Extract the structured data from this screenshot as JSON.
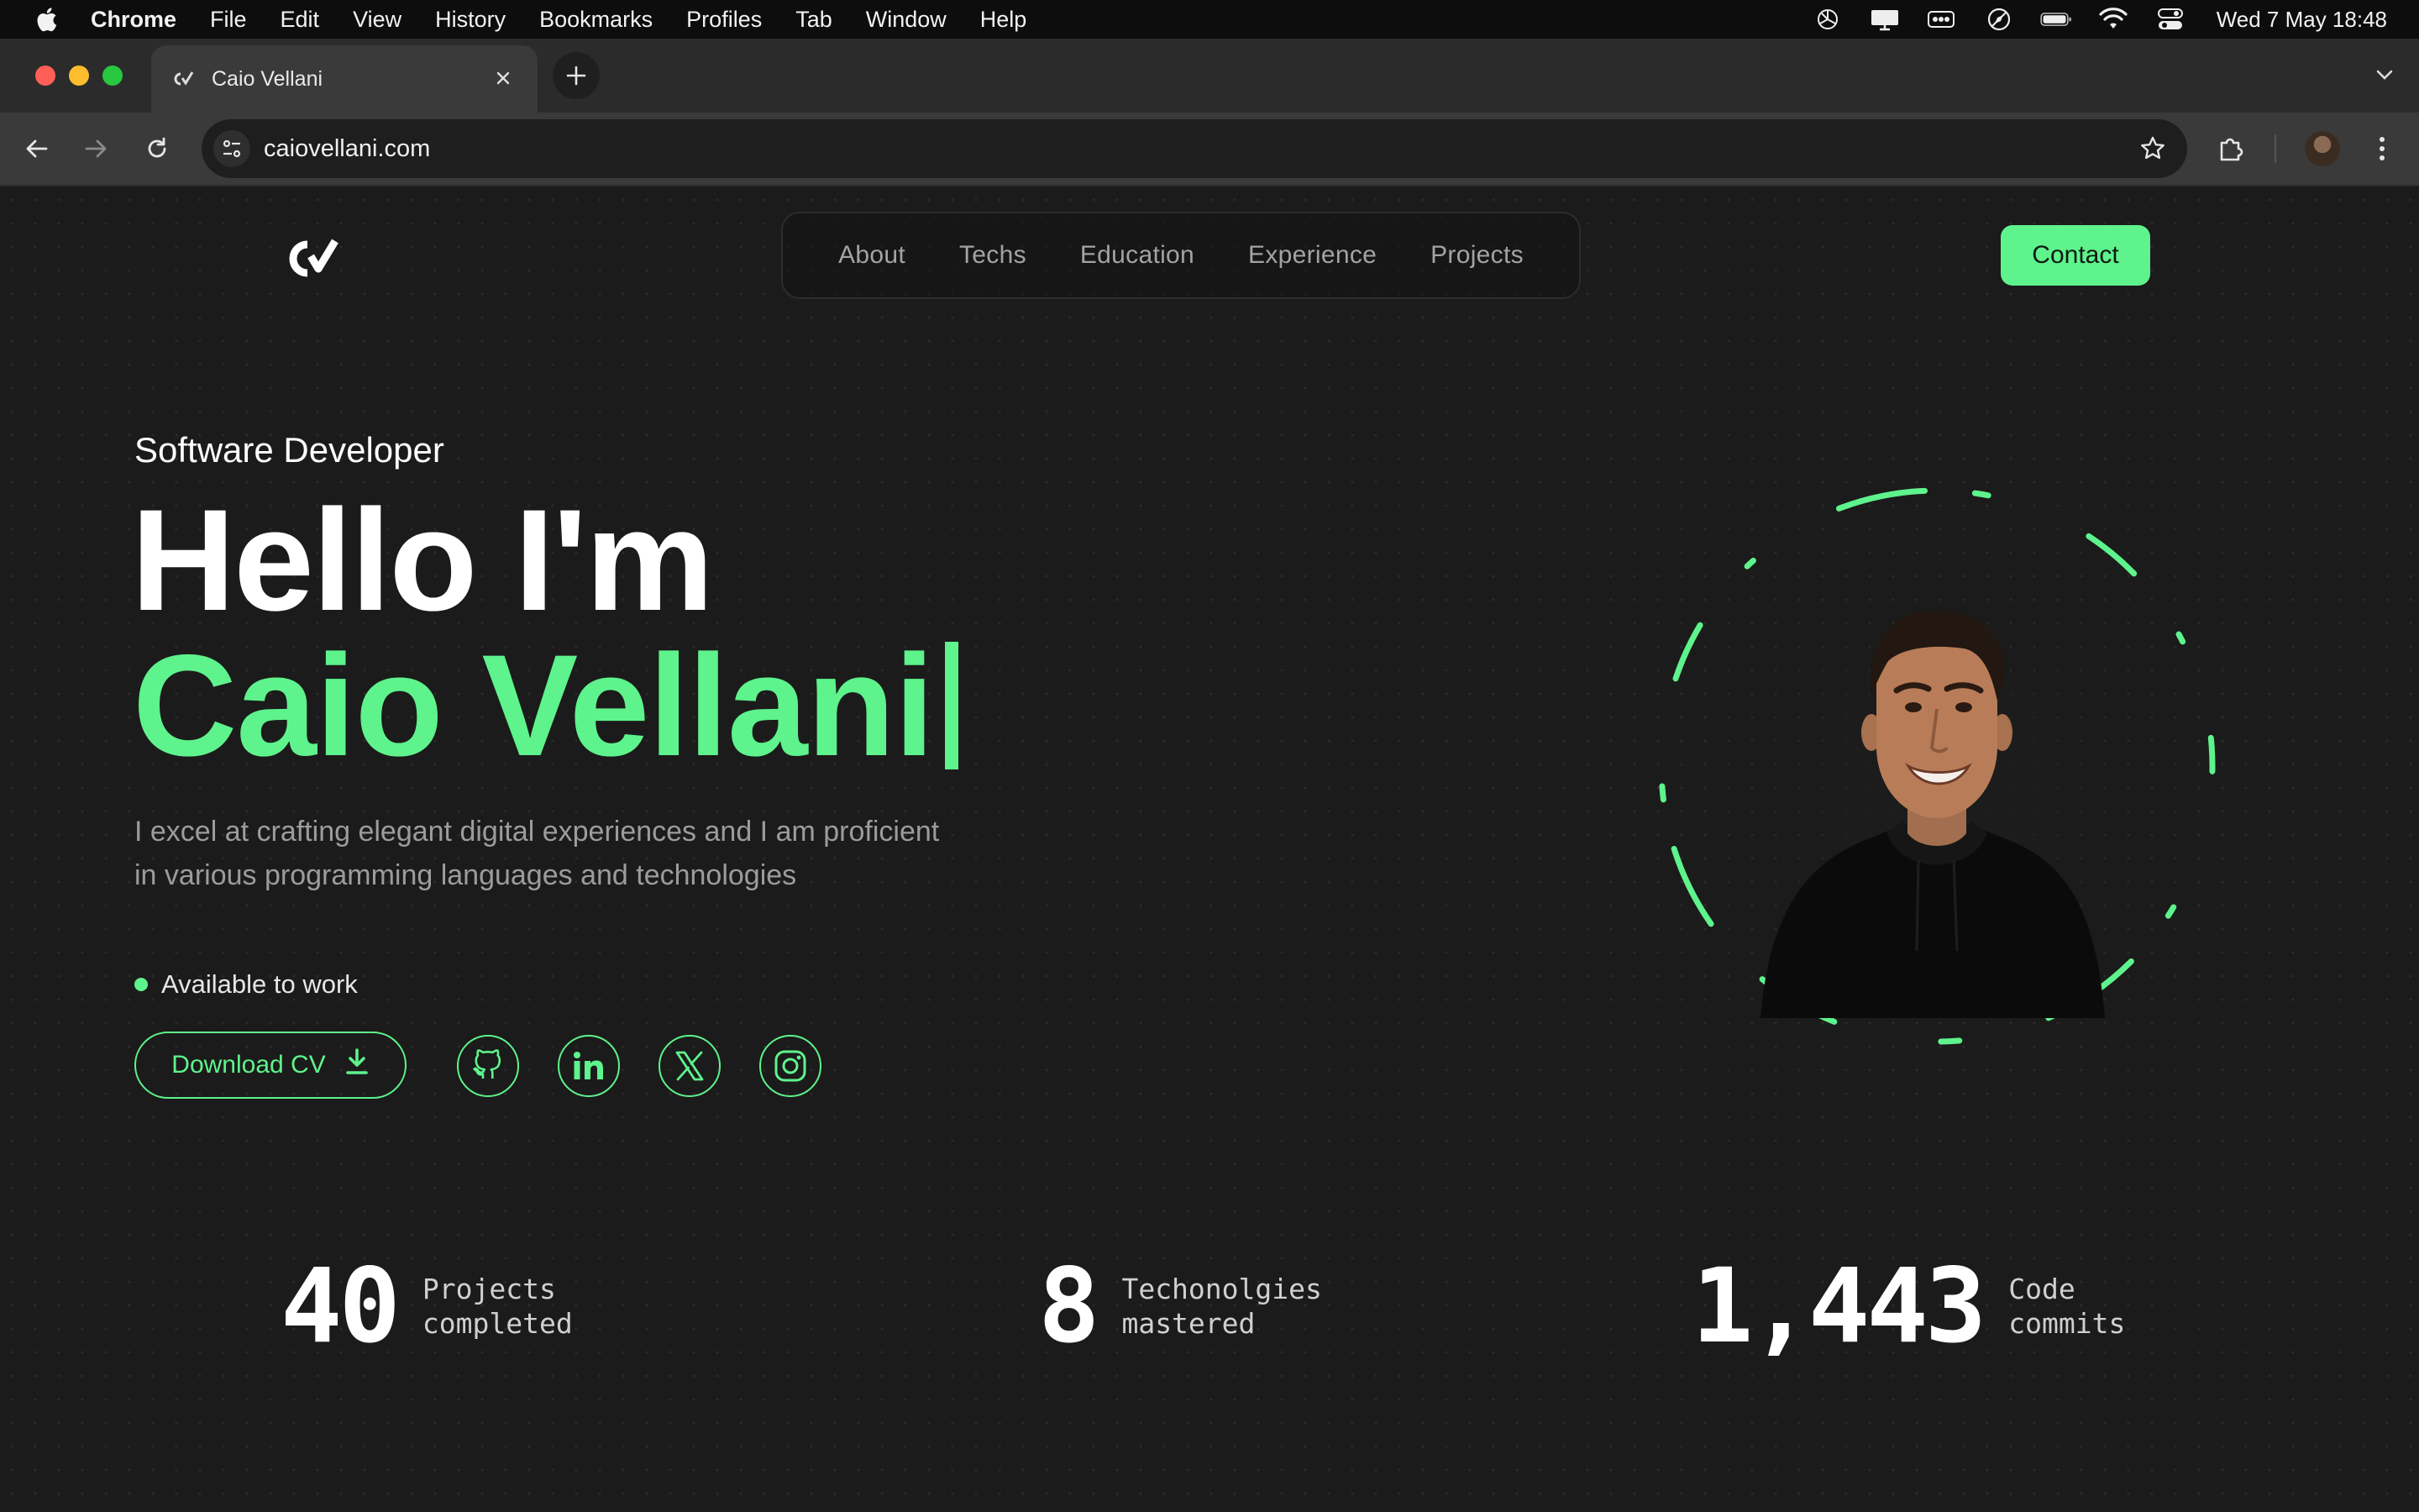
{
  "menubar": {
    "app_name": "Chrome",
    "items": [
      "File",
      "Edit",
      "View",
      "History",
      "Bookmarks",
      "Profiles",
      "Tab",
      "Window",
      "Help"
    ],
    "status_icons": [
      "chatgpt-icon",
      "display-icon",
      "battery-menu-icon",
      "compass-icon",
      "battery-icon",
      "wifi-icon",
      "control-center-icon"
    ],
    "clock": "Wed 7 May  18:48"
  },
  "browser": {
    "tab_title": "Caio Vellani",
    "url": "caiovellani.com"
  },
  "site": {
    "nav": [
      "About",
      "Techs",
      "Education",
      "Experience",
      "Projects"
    ],
    "contact_label": "Contact",
    "role": "Software Developer",
    "greeting": "Hello I'm",
    "name": "Caio Vellani",
    "description": "I excel at crafting elegant digital experiences and I am proficient in various programming languages and technologies",
    "availability": "Available to work",
    "download_label": "Download CV",
    "socials": [
      "github-icon",
      "linkedin-icon",
      "x-icon",
      "instagram-icon"
    ],
    "stats": [
      {
        "value": "40",
        "label_line1": "Projects",
        "label_line2": "completed"
      },
      {
        "value": "8",
        "label_line1": "Techonolgies",
        "label_line2": "mastered"
      },
      {
        "value": "1,443",
        "label_line1": "Code",
        "label_line2": "commits"
      }
    ]
  },
  "colors": {
    "accent": "#5ef38c",
    "background": "#1b1b1b",
    "muted_text": "#9c9c9c"
  }
}
